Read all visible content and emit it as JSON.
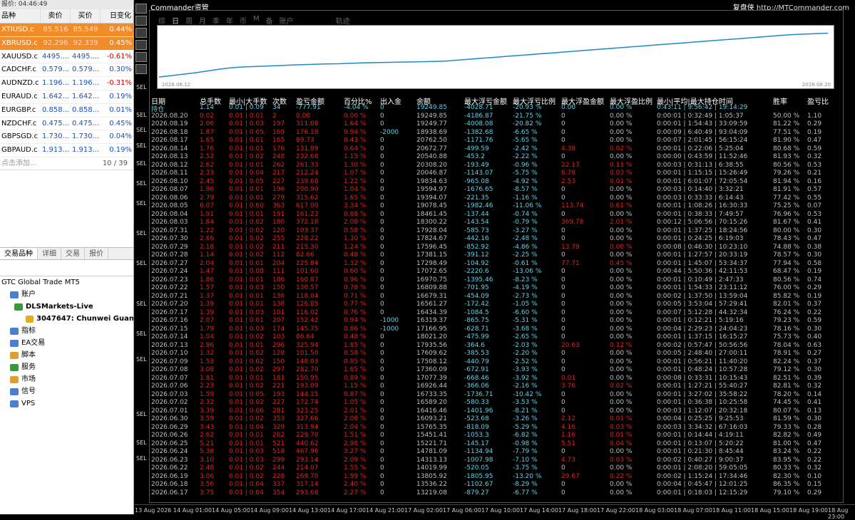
{
  "market_watch": {
    "title": "报价: 04:46:49",
    "headers": [
      "品种",
      "卖价",
      "买价",
      "日变化"
    ],
    "rows": [
      {
        "symbol": "XTIUSD.c",
        "bid": "85.516",
        "ask": "85.549",
        "change": "0.44%",
        "hl": true,
        "neg": false
      },
      {
        "symbol": "XBRUSD.c",
        "bid": "92.296",
        "ask": "92.339",
        "change": "0.45%",
        "hl": true,
        "neg": false
      },
      {
        "symbol": "XAUUSD.c",
        "bid": "4495....",
        "ask": "4495....",
        "change": "-0.61%",
        "hl": false,
        "neg": true
      },
      {
        "symbol": "CADCHF.c",
        "bid": "0.579...",
        "ask": "0.579...",
        "change": "0.30%",
        "hl": false,
        "neg": false
      },
      {
        "symbol": "AUDNZD.c",
        "bid": "1.196...",
        "ask": "1.196...",
        "change": "-0.31%",
        "hl": false,
        "neg": true
      },
      {
        "symbol": "EURAUD.c",
        "bid": "1.642...",
        "ask": "1.642...",
        "change": "0.19%",
        "hl": false,
        "neg": false
      },
      {
        "symbol": "EURGBP.c",
        "bid": "0.858...",
        "ask": "0.858...",
        "change": "0.01%",
        "hl": false,
        "neg": false
      },
      {
        "symbol": "NZDCHF.c",
        "bid": "0.475...",
        "ask": "0.475...",
        "change": "0.45%",
        "hl": false,
        "neg": false
      },
      {
        "symbol": "GBPSGD.c",
        "bid": "1.730...",
        "ask": "1.730...",
        "change": "0.04%",
        "hl": false,
        "neg": false
      },
      {
        "symbol": "GBPAUD.c",
        "bid": "1.913...",
        "ask": "1.913...",
        "change": "0.19%",
        "hl": false,
        "neg": false
      }
    ],
    "add_text": "点击添加...",
    "count": "10 / 39",
    "tabs": [
      "交易品种",
      "详细",
      "交易",
      "报价"
    ]
  },
  "navigator": {
    "root": "GTC Global Trade MT5",
    "items": [
      {
        "label": "账户",
        "bold": false,
        "indent": 14,
        "icon": "account-icon",
        "color": "#4a7fd4"
      },
      {
        "label": "DLSMarkets-Live",
        "bold": true,
        "indent": 20,
        "icon": "server-icon",
        "color": "#3a9a3a"
      },
      {
        "label": "3047647: Chunwei Guan",
        "bold": true,
        "indent": 36,
        "icon": "user-icon",
        "color": "#e0b020"
      },
      {
        "label": "指标",
        "bold": false,
        "indent": 14,
        "icon": "indicator-icon",
        "color": "#4a7fd4"
      },
      {
        "label": "EA交易",
        "bold": false,
        "indent": 14,
        "icon": "ea-icon",
        "color": "#4a7fd4"
      },
      {
        "label": "脚本",
        "bold": false,
        "indent": 14,
        "icon": "script-icon",
        "color": "#e0a030"
      },
      {
        "label": "服务",
        "bold": false,
        "indent": 14,
        "icon": "service-icon",
        "color": "#3a9a3a"
      },
      {
        "label": "市场",
        "bold": false,
        "indent": 14,
        "icon": "market-icon",
        "color": "#e0a030"
      },
      {
        "label": "信号",
        "bold": false,
        "indent": 14,
        "icon": "signal-icon",
        "color": "#4a7fd4"
      },
      {
        "label": "VPS",
        "bold": false,
        "indent": 14,
        "icon": "vps-icon",
        "color": "#4a7fd4"
      }
    ]
  },
  "chart_window": {
    "title": "Commander资管",
    "right_brand": "复盘侠",
    "right_link": "http://MTCommander.com",
    "sell_label": "SEL",
    "tabs": [
      "综",
      "日",
      "周",
      "月",
      "季",
      "年",
      "币",
      "M",
      "备",
      "账户",
      "轨迹"
    ],
    "active_tab": 1,
    "equity_start": "2026.06.12",
    "equity_end": "2026.08.20",
    "equity_points": [
      0.03,
      0.06,
      0.09,
      0.12,
      0.16,
      0.2,
      0.23,
      0.25,
      0.26,
      0.27,
      0.28,
      0.29,
      0.3,
      0.31,
      0.315,
      0.32,
      0.33,
      0.34,
      0.345,
      0.35,
      0.355,
      0.36,
      0.365,
      0.37,
      0.38,
      0.4,
      0.42,
      0.44,
      0.46,
      0.48,
      0.5,
      0.52,
      0.54,
      0.56,
      0.58,
      0.6,
      0.62,
      0.64,
      0.66,
      0.68,
      0.7,
      0.72,
      0.74,
      0.76,
      0.78,
      0.8,
      0.82,
      0.84,
      0.86,
      0.88,
      0.9,
      0.92,
      0.94,
      0.96,
      0.97,
      0.98,
      0.99
    ]
  },
  "stats_table": {
    "headers": [
      "日期",
      "总手数",
      "最小|大手数",
      "次数",
      "盈亏金额",
      "百分比%",
      "出入金",
      "余额",
      "最大浮亏金额",
      "最大浮亏比例",
      "最大浮盈金额",
      "最大浮盈比例",
      "最小|平均|最大持仓时间",
      "胜率",
      "盈亏比"
    ],
    "hold_row": [
      "持仓",
      "1.14",
      "0.01 | 0.09",
      "34",
      "-777.91",
      "-4.04 %",
      "0",
      "19249.85",
      "-4028.71",
      "-20.93 %",
      "0.00",
      "0.00 %",
      "0:43:11 | 9:56:42 | 19:14:29",
      "",
      ""
    ],
    "rows": [
      [
        "2026.08.20",
        "0.02",
        "0.01 | 0.01",
        "2",
        "0.08",
        "0.00 %",
        "0",
        "19249.85",
        "-4186.87",
        "-21.75 %",
        "0",
        "0.00 %",
        "0:00:01 | 0:32:49 | 1:05:37",
        "50.00 %",
        "1.10"
      ],
      [
        "2026.08.19",
        "2.06",
        "0.01 | 0.03",
        "197",
        "311.08",
        "1.64 %",
        "0",
        "19249.77",
        "-4008.08",
        "-20.82 %",
        "0",
        "0.00 %",
        "0:00:01 | 1:54:43 | 33:09:59",
        "81.22 %",
        "0.29"
      ],
      [
        "2026.08.18",
        "1.87",
        "0.01 | 0.05",
        "169",
        "176.18",
        "0.94 %",
        "-2000",
        "18938.69",
        "-1382.68",
        "-6.65 %",
        "0",
        "0.00 %",
        "0:00:09 | 6:40:49 | 93:04:09",
        "77.51 %",
        "0.19"
      ],
      [
        "2026.08.17",
        "1.65",
        "0.01 | 0.01",
        "165",
        "89.73",
        "0.43 %",
        "0",
        "20762.50",
        "-1171.76",
        "-5.65 %",
        "0",
        "0.00 %",
        "0:00:07 | 2:01:45 | 56:15:24",
        "81.90 %",
        "0.47"
      ],
      [
        "2026.08.14",
        "1.76",
        "0.01 | 0.01",
        "176",
        "131.89",
        "0.64 %",
        "0",
        "20672.77",
        "-499.59",
        "-2.42 %",
        "4.38",
        "0.02 %",
        "0:00:01 | 0:22:06 | 5:25:04",
        "80.68 %",
        "0.59"
      ],
      [
        "2026.08.13",
        "2.52",
        "0.01 | 0.02",
        "248",
        "232.68",
        "1.15 %",
        "0",
        "20540.88",
        "-453.2",
        "-2.22 %",
        "0",
        "0.00 %",
        "0:00:00 | 0:43:59 | 11:52:46",
        "81.93 %",
        "0.32"
      ],
      [
        "2026.08.12",
        "2.62",
        "0.01 | 0.01",
        "262",
        "261.33",
        "1.30 %",
        "0",
        "20308.20",
        "-193.49",
        "-0.96 %",
        "22.17",
        "0.11 %",
        "0:00:03 | 0:31:13 | 6:38:55",
        "80.56 %",
        "0.53"
      ],
      [
        "2026.08.11",
        "2.33",
        "0.01 | 0.04",
        "217",
        "212.24",
        "1.07 %",
        "0",
        "20046.87",
        "-1143.07",
        "-5.75 %",
        "6.78",
        "0.03 %",
        "0:00:01 | 1:15:15 | 15:26:49",
        "79.26 %",
        "0.21"
      ],
      [
        "2026.08.10",
        "2.45",
        "0.01 | 0.05",
        "227",
        "239.68",
        "1.22 %",
        "0",
        "19834.63",
        "-965.08",
        "-4.92 %",
        "2.53",
        "0.01 %",
        "0:00:01 | 6:01:07 | 72:05:54",
        "81.94 %",
        "0.16"
      ],
      [
        "2026.08.07",
        "1.96",
        "0.01 | 0.01",
        "196",
        "200.90",
        "1.04 %",
        "0",
        "19594.97",
        "-1676.65",
        "-8.57 %",
        "0",
        "0.00 %",
        "0:00:03 | 0:14:40 | 3:32:21",
        "81.91 %",
        "0.57"
      ],
      [
        "2026.08.06",
        "2.79",
        "0.01 | 0.01",
        "279",
        "315.62",
        "1.65 %",
        "0",
        "19394.07",
        "-221.35",
        "-1.16 %",
        "0",
        "0.00 %",
        "0:00:03 | 0:33:33 | 6:14:43",
        "77.42 %",
        "0.55"
      ],
      [
        "2026.08.05",
        "6.07",
        "0.01 | 0.60",
        "363",
        "617.00",
        "3.34 %",
        "0",
        "19078.45",
        "-1982.46",
        "-11.06 %",
        "113.74",
        "0.61 %",
        "0:00:01 | 1:08:26 | 16:30:33",
        "75.25 %",
        "0.07"
      ],
      [
        "2026.08.04",
        "1.91",
        "0.01 | 0.01",
        "191",
        "161.23",
        "0.88 %",
        "0",
        "18461.45",
        "-137.44",
        "-0.74 %",
        "0",
        "0.00 %",
        "0:00:01 | 0:38:33 | 7:49:57",
        "76.96 %",
        "0.53"
      ],
      [
        "2026.08.03",
        "1.84",
        "0.01 | 0.02",
        "180",
        "372.18",
        "2.08 %",
        "0",
        "18300.22",
        "-143.54",
        "-0.79 %",
        "369.78",
        "2.01 %",
        "0:00:12 | 5:06:56 | 70:15:26",
        "81.67 %",
        "0.41"
      ],
      [
        "2026.07.31",
        "1.22",
        "0.01 | 0.02",
        "120",
        "103.37",
        "0.58 %",
        "0",
        "17928.04",
        "-585.73",
        "-3.27 %",
        "0",
        "0.00 %",
        "0:00:01 | 1:37:25 | 18:24:56",
        "80.00 %",
        "0.30"
      ],
      [
        "2026.07.30",
        "2.66",
        "0.01 | 0.02",
        "255",
        "228.22",
        "1.30 %",
        "0",
        "17824.67",
        "-442.16",
        "-2.48 %",
        "0",
        "0.00 %",
        "0:00:01 | 0:24:25 | 6:19:03",
        "78.43 %",
        "0.47"
      ],
      [
        "2026.07.29",
        "2.18",
        "0.01 | 0.02",
        "211",
        "215.30",
        "1.24 %",
        "0",
        "17596.45",
        "-852.92",
        "-4.86 %",
        "13.79",
        "0.08 %",
        "0:00:08 | 0:46:30 | 10:23:10",
        "74.88 %",
        "0.38"
      ],
      [
        "2026.07.28",
        "1.14",
        "0.01 | 0.02",
        "112",
        "82.66",
        "0.48 %",
        "0",
        "17381.15",
        "-391.12",
        "-2.25 %",
        "0",
        "0.00 %",
        "0:00:01 | 1:27:57 | 20:33:19",
        "78.57 %",
        "0.30"
      ],
      [
        "2026.07.27",
        "2.04",
        "0.01 | 0.01",
        "204",
        "225.84",
        "1.32 %",
        "0",
        "17298.49",
        "-104.92",
        "-0.61 %",
        "77.71",
        "0.45 %",
        "0:00:01 | 1:45:07 | 53:34:37",
        "77.94 %",
        "0.58"
      ],
      [
        "2026.07.24",
        "1.47",
        "0.01 | 0.08",
        "111",
        "101.60",
        "0.60 %",
        "0",
        "17072.65",
        "-2220.6",
        "-13.06 %",
        "0",
        "0.00 %",
        "0:00:44 | 5:50:36 | 42:11:53",
        "68.47 %",
        "0.19"
      ],
      [
        "2026.07.23",
        "1.86",
        "0.01 | 0.01",
        "186",
        "160.87",
        "0.96 %",
        "0",
        "16970.75",
        "-1395.46",
        "-8.23 %",
        "0",
        "0.00 %",
        "0:00:01 | 0:10:49 | 2:47:33",
        "80.56 %",
        "0.74"
      ],
      [
        "2026.07.22",
        "1.57",
        "0.01 | 0.03",
        "150",
        "130.57",
        "0.78 %",
        "0",
        "16809.88",
        "-701.95",
        "-4.19 %",
        "0",
        "0.00 %",
        "0:00:01 | 1:54:33 | 23:11:12",
        "76.00 %",
        "0.29"
      ],
      [
        "2026.07.21",
        "1.37",
        "0.01 | 0.01",
        "136",
        "118.04",
        "0.71 %",
        "0",
        "16679.31",
        "-454.09",
        "-2.73 %",
        "0",
        "0.00 %",
        "0:00:02 | 1:37:50 | 13:59:04",
        "85.82 %",
        "0.19"
      ],
      [
        "2026.07.20",
        "1.39",
        "0.01 | 0.01",
        "138",
        "126.85",
        "0.77 %",
        "0",
        "16561.27",
        "-172.42",
        "-1.05 %",
        "0",
        "0.00 %",
        "0:00:05 | 3:53:04 | 57:29:41",
        "82.01 %",
        "0.37"
      ],
      [
        "2026.07.17",
        "1.39",
        "0.01 | 0.03",
        "101",
        "116.02",
        "0.76 %",
        "0",
        "16434.39",
        "-1084.5",
        "-6.60 %",
        "0",
        "0.00 %",
        "0:00:07 | 5:12:28 | 44:32:34",
        "76.24 %",
        "0.22"
      ],
      [
        "2026.07.16",
        "2.07",
        "0.01 | 0.01",
        "207",
        "152.42",
        "0.94 %",
        "-1000",
        "16319.37",
        "-865.75",
        "-5.31 %",
        "0",
        "0.00 %",
        "0:00:01 | 0:12:21 | 5:19:16",
        "79.23 %",
        "0.59"
      ],
      [
        "2026.07.15",
        "1.79",
        "0.01 | 0.03",
        "174",
        "145.75",
        "0.86 %",
        "-1000",
        "17166.95",
        "-628.71",
        "-3.68 %",
        "0",
        "0.00 %",
        "0:00:04 | 2:29:23 | 24:04:23",
        "78.16 %",
        "0.30"
      ],
      [
        "2026.07.14",
        "1.04",
        "0.01 | 0.02",
        "103",
        "86.64",
        "0.48 %",
        "0",
        "18021.20",
        "-475.99",
        "-2.65 %",
        "0",
        "0.00 %",
        "0:00:01 | 1:37:15 | 16:15:27",
        "75.73 %",
        "0.40"
      ],
      [
        "2026.07.13",
        "2.96",
        "0.01 | 0.01",
        "296",
        "325.94",
        "1.85 %",
        "0",
        "17935.56",
        "-364.6",
        "-2.03 %",
        "20.63",
        "0.12 %",
        "0:00:02 | 0:57:47 | 50:56:56",
        "78.04 %",
        "0.63"
      ],
      [
        "2026.07.10",
        "1.32",
        "0.01 | 0.02",
        "128",
        "101.50",
        "0.58 %",
        "0",
        "17609.62",
        "-385.53",
        "-2.20 %",
        "0",
        "0.00 %",
        "0:00:05 | 2:48:40 | 27:00:11",
        "78.91 %",
        "0.27"
      ],
      [
        "2026.07.09",
        "1.53",
        "0.01 | 0.02",
        "150",
        "148.03",
        "0.85 %",
        "0",
        "17508.12",
        "-440.79",
        "-2.52 %",
        "0",
        "0.00 %",
        "0:00:01 | 0:56:21 | 11:40:20",
        "82.24 %",
        "0.37"
      ],
      [
        "2026.07.08",
        "3.08",
        "0.01 | 0.02",
        "297",
        "282.70",
        "1.65 %",
        "0",
        "17360.09",
        "-672.91",
        "-3.93 %",
        "0",
        "0.00 %",
        "0:00:01 | 0:48:24 | 10:57:28",
        "79.12 %",
        "0.30"
      ],
      [
        "2026.07.07",
        "1.81",
        "0.01 | 0.01",
        "181",
        "150.95",
        "0.89 %",
        "0",
        "17077.39",
        "-668.46",
        "-3.92 %",
        "0.01",
        "0.00 %",
        "0:00:08 | 0:33:31 | 10:15:43",
        "82.51 %",
        "0.39"
      ],
      [
        "2026.07.06",
        "2.23",
        "0.01 | 0.02",
        "221",
        "193.09",
        "1.15 %",
        "0",
        "16926.44",
        "-366.06",
        "-2.16 %",
        "3.76",
        "0.02 %",
        "0:00:01 | 1:27:21 | 55:40:27",
        "82.81 %",
        "0.32"
      ],
      [
        "2026.07.03",
        "1.59",
        "0.01 | 0.05",
        "193",
        "144.15",
        "0.87 %",
        "0",
        "16733.35",
        "-1736.71",
        "-10.42 %",
        "0",
        "0.00 %",
        "0:00:01 | 3:27:02 | 35:58:22",
        "78.20 %",
        "0.14"
      ],
      [
        "2026.07.02",
        "2.32",
        "0.01 | 0.02",
        "227",
        "172.74",
        "1.05 %",
        "0",
        "16589.20",
        "-580.33",
        "-3.53 %",
        "0",
        "0.00 %",
        "0:00:01 | 0:36:38 | 10:25:58",
        "74.45 %",
        "0.41"
      ],
      [
        "2026.07.01",
        "3.39",
        "0.01 | 0.06",
        "281",
        "323.25",
        "2.01 %",
        "0",
        "16416.46",
        "-1401.96",
        "-8.21 %",
        "0",
        "0.00 %",
        "0:00:03 | 1:12:07 | 20:32:18",
        "80.07 %",
        "0.13"
      ],
      [
        "2026.06.30",
        "3.59",
        "0.01 | 0.02",
        "353",
        "327.66",
        "2.08 %",
        "0",
        "16093.21",
        "-523.68",
        "-3.26 %",
        "2.12",
        "0.01 %",
        "0:00:04 | 0:25:25 | 9:25:53",
        "81.59 %",
        "0.30"
      ],
      [
        "2026.06.29",
        "3.43",
        "0.01 | 0.04",
        "329",
        "313.94",
        "2.04 %",
        "0",
        "15765.35",
        "-818.09",
        "-5.29 %",
        "4.16",
        "0.03 %",
        "0:00:03 | 3:34:32 | 67:16:03",
        "79.33 %",
        "0.28"
      ],
      [
        "2026.06.26",
        "2.62",
        "0.01 | 0.01",
        "262",
        "229.70",
        "1.51 %",
        "0",
        "15451.41",
        "-1053.3",
        "-6.82 %",
        "1.16",
        "0.01 %",
        "0:00:01 | 0:14:44 | 4:19:11",
        "82.82 %",
        "0.49"
      ],
      [
        "2026.06.25",
        "5.21",
        "0.01 | 0.01",
        "521",
        "440.62",
        "2.98 %",
        "0",
        "15221.71",
        "-145.17",
        "-0.98 %",
        "5.51",
        "0.04 %",
        "0:00:01 | 0:13:07 | 5:20:22",
        "81.00 %",
        "0.47"
      ],
      [
        "2026.06.24",
        "5.38",
        "0.01 | 0.03",
        "518",
        "467.96",
        "3.27 %",
        "0",
        "14781.09",
        "-1134.94",
        "-7.79 %",
        "0",
        "0.00 %",
        "0:00:01 | 0:21:30 | 8:45:44",
        "83.24 %",
        "0.22"
      ],
      [
        "2026.06.23",
        "3.10",
        "0.01 | 0.03",
        "299",
        "293.14",
        "2.09 %",
        "0",
        "14313.13",
        "-1007.98",
        "-7.10 %",
        "4.73",
        "0.03 %",
        "0:00:02 | 0:40:27 | 9:00:37",
        "83.95 %",
        "0.22"
      ],
      [
        "2026.06.22",
        "2.48",
        "0.01 | 0.02",
        "244",
        "214.07",
        "1.55 %",
        "0",
        "14019.99",
        "-520.05",
        "-3.75 %",
        "0",
        "0.00 %",
        "0:00:01 | 2:08:20 | 59:05:05",
        "80.33 %",
        "0.32"
      ],
      [
        "2026.06.19",
        "3.06",
        "0.01 | 0.02",
        "228",
        "269.70",
        "1.99 %",
        "0",
        "13805.92",
        "-1805.95",
        "-13.20 %",
        "29.67",
        "0.22 %",
        "0:00:02 | 1:15:24 | 17:34:46",
        "82.30 %",
        "0.10"
      ],
      [
        "2026.06.18",
        "3.56",
        "0.01 | 0.04",
        "337",
        "317.14",
        "2.40 %",
        "0",
        "13536.22",
        "-1102.67",
        "-8.29 %",
        "0",
        "0.00 %",
        "0:00:04 | 0:45:47 | 12:01:25",
        "86.35 %",
        "0.15"
      ],
      [
        "2026.06.17",
        "3.75",
        "0.01 | 0.04",
        "354",
        "293.68",
        "2.27 %",
        "0",
        "13219.08",
        "-879.27",
        "-6.77 %",
        "0",
        "0.00 %",
        "0:00:01 | 0:18:03 | 12:15:29",
        "79.10 %",
        "0.29"
      ]
    ]
  },
  "x_axis": [
    "13 Aug 2026",
    "14 Aug 01:00",
    "14 Aug 05:00",
    "14 Aug 09:00",
    "14 Aug 13:00",
    "14 Aug 17:00",
    "14 Aug 21:00",
    "17 Aug 02:00",
    "17 Aug 06:00",
    "17 Aug 10:00",
    "17 Aug 14:00",
    "17 Aug 18:00",
    "17 Aug 22:00",
    "18 Aug 03:00",
    "18 Aug 07:00",
    "18 Aug 11:00",
    "18 Aug 15:00",
    "18 Aug 19:00",
    "18 Aug 23:00"
  ]
}
